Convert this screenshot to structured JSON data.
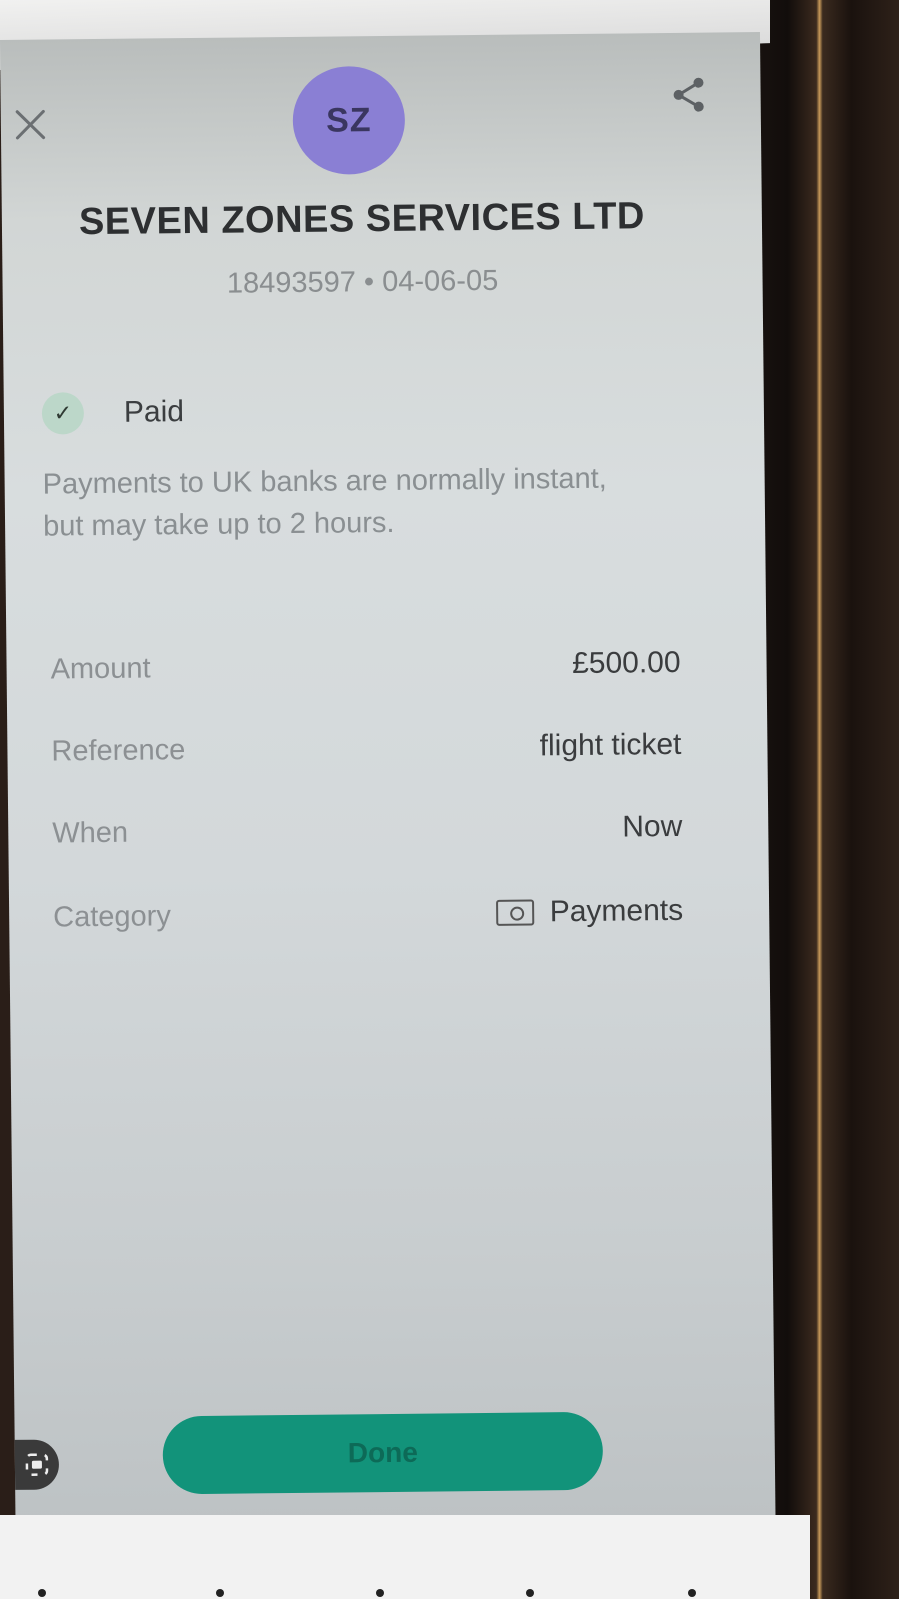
{
  "header": {
    "close_icon": "close-icon",
    "share_icon": "share-icon",
    "avatar_initials": "SZ",
    "avatar_color": "#8a7fd4"
  },
  "payee": {
    "name": "SEVEN ZONES SERVICES LTD",
    "details": "18493597 • 04-06-05"
  },
  "status": {
    "icon": "check-icon",
    "label": "Paid",
    "notice": "Payments to UK banks are normally instant, but may take up to 2 hours."
  },
  "details": [
    {
      "key": "Amount",
      "value": "£500.00"
    },
    {
      "key": "Reference",
      "value": "flight ticket"
    },
    {
      "key": "When",
      "value": "Now"
    },
    {
      "key": "Category",
      "value": "Payments",
      "icon": "wallet-icon"
    }
  ],
  "actions": {
    "done_label": "Done",
    "done_color": "#12937a"
  }
}
